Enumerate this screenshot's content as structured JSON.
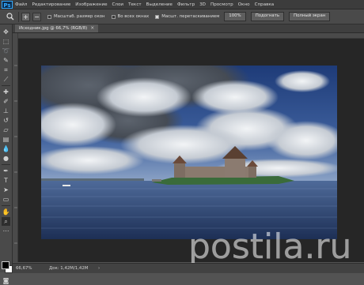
{
  "app": {
    "logo": "Ps"
  },
  "menu": [
    "Файл",
    "Редактирование",
    "Изображение",
    "Слои",
    "Текст",
    "Выделение",
    "Фильтр",
    "3D",
    "Просмотр",
    "Окно",
    "Справка"
  ],
  "options": {
    "tool_icon": "zoom-icon",
    "zoom_in": "+",
    "zoom_out": "−",
    "check_resize": {
      "label": "Масштаб. размер окон",
      "checked": false
    },
    "check_all_windows": {
      "label": "Во всех окнах",
      "checked": false
    },
    "check_scrubby": {
      "label": "Масшт. перетаскиванием",
      "checked": true
    },
    "btn_100": "100%",
    "btn_fit": "Подогнать",
    "btn_fill": "Полный экран"
  },
  "document": {
    "tab_label": "Исходник.jpg @ 66,7% (RGB/8)",
    "tab_close": "×"
  },
  "status": {
    "zoom": "66,67%",
    "doc_info": "Док: 1,42М/1,42М",
    "arrow": "›"
  },
  "watermark": {
    "text": "postila.ru"
  },
  "colors": {
    "foreground": "#000000",
    "background": "#ffffff",
    "accent": "#31a8ff"
  }
}
